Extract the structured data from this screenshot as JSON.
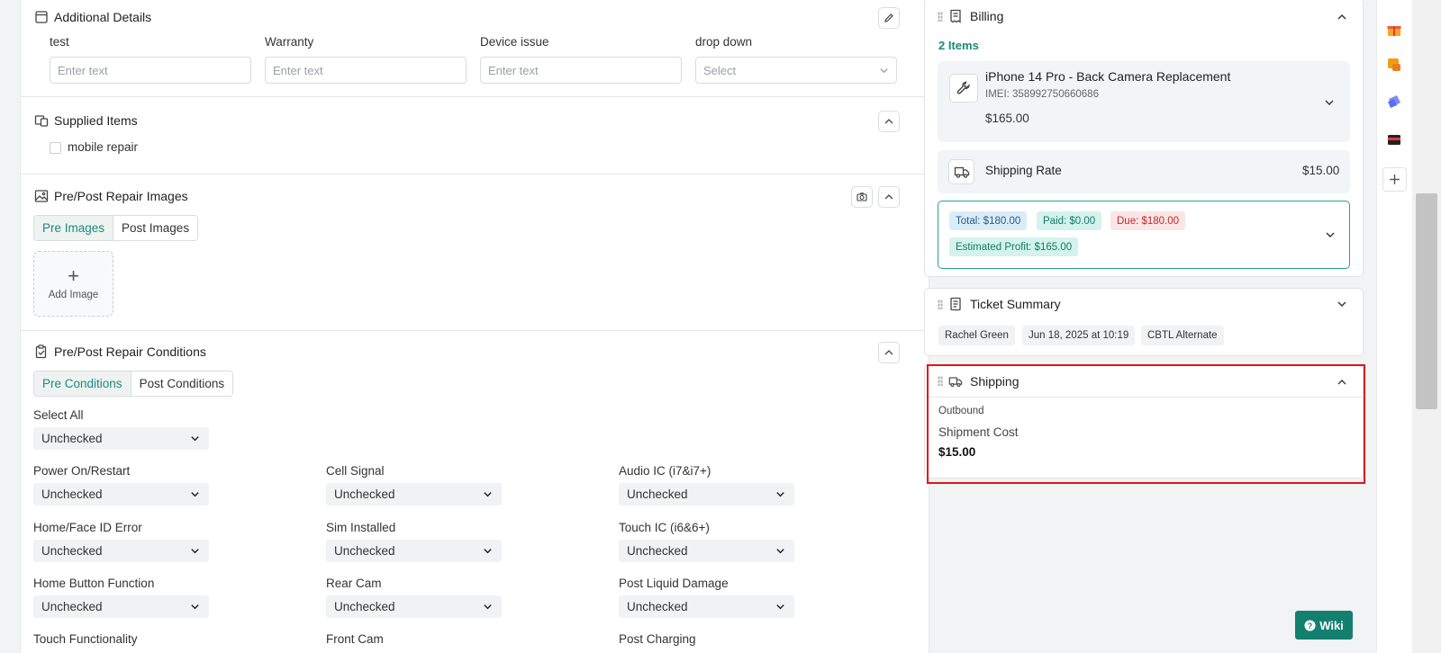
{
  "additional_details": {
    "title": "Additional Details",
    "fields": [
      {
        "label": "test",
        "placeholder": "Enter text"
      },
      {
        "label": "Warranty",
        "placeholder": "Enter text"
      },
      {
        "label": "Device issue",
        "placeholder": "Enter text"
      }
    ],
    "dropdown": {
      "label": "drop down",
      "placeholder": "Select"
    }
  },
  "supplied_items": {
    "title": "Supplied Items",
    "items": [
      {
        "label": "mobile repair",
        "checked": false
      }
    ]
  },
  "repair_images": {
    "title": "Pre/Post Repair Images",
    "tabs": [
      "Pre Images",
      "Post Images"
    ],
    "active_tab": "Pre Images",
    "add_label": "Add Image"
  },
  "repair_conditions": {
    "title": "Pre/Post Repair Conditions",
    "tabs": [
      "Pre Conditions",
      "Post Conditions"
    ],
    "active_tab": "Pre Conditions",
    "select_all": {
      "label": "Select All",
      "value": "Unchecked"
    },
    "conditions": [
      {
        "label": "Power On/Restart",
        "value": "Unchecked"
      },
      {
        "label": "Cell Signal",
        "value": "Unchecked"
      },
      {
        "label": "Audio IC (i7&i7+)",
        "value": "Unchecked"
      },
      {
        "label": "Home/Face ID Error",
        "value": "Unchecked"
      },
      {
        "label": "Sim Installed",
        "value": "Unchecked"
      },
      {
        "label": "Touch IC (i6&6+)",
        "value": "Unchecked"
      },
      {
        "label": "Home Button Function",
        "value": "Unchecked"
      },
      {
        "label": "Rear Cam",
        "value": "Unchecked"
      },
      {
        "label": "Post Liquid Damage",
        "value": "Unchecked"
      },
      {
        "label": "Touch Functionality",
        "value": ""
      },
      {
        "label": "Front Cam",
        "value": ""
      },
      {
        "label": "Post Charging",
        "value": ""
      }
    ]
  },
  "billing": {
    "title": "Billing",
    "items_count": "2 Items",
    "item": {
      "name": "iPhone 14 Pro - Back Camera Replacement",
      "imei": "IMEI: 358992750660686",
      "price": "$165.00"
    },
    "shipping_rate": {
      "label": "Shipping Rate",
      "amount": "$15.00"
    },
    "badges": {
      "total": "Total: $180.00",
      "paid": "Paid: $0.00",
      "due": "Due: $180.00",
      "profit": "Estimated Profit: $165.00"
    }
  },
  "ticket_summary": {
    "title": "Ticket Summary",
    "chips": [
      "Rachel Green",
      "Jun 18, 2025 at 10:19",
      "CBTL Alternate"
    ]
  },
  "shipping": {
    "title": "Shipping",
    "direction": "Outbound",
    "cost_label": "Shipment Cost",
    "cost_value": "$15.00"
  },
  "wiki_button": "Wiki",
  "colors": {
    "accent": "#1a8a7a",
    "highlight": "#e0151b",
    "total_bg": "#dcecf7",
    "paid_bg": "#d4f3ec",
    "due_bg": "#fbe5e5",
    "wiki_bg": "#13806f"
  }
}
